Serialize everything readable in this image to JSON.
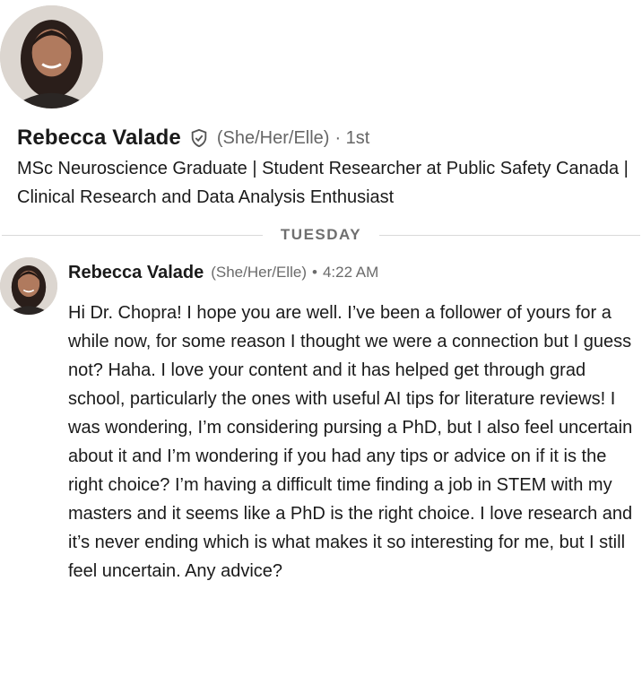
{
  "profile": {
    "name": "Rebecca Valade",
    "pronouns": "(She/Her/Elle)",
    "degree": "· 1st",
    "headline": "MSc Neuroscience Graduate | Student Researcher at Public Safety Canada | Clinical Research and Data Analysis Enthusiast",
    "verified_icon": "shield-check-icon"
  },
  "divider": {
    "label": "TUESDAY"
  },
  "message": {
    "sender": "Rebecca Valade",
    "pronouns": "(She/Her/Elle)",
    "separator": "•",
    "time": "4:22 AM",
    "text": "Hi Dr. Chopra! I hope you are well. I’ve been a follower of yours for a while now, for some reason I thought we were a connection but I guess not? Haha. I love your content and it has helped get through grad school, particularly the ones with useful AI tips for literature reviews! I was wondering, I’m considering pursing a PhD, but I also feel uncertain about it and I’m wondering if you had any tips or advice on if it is the right choice? I’m having a difficult time finding a job in STEM with my masters and it seems like a PhD is the right choice. I love research and it’s never ending which is what makes it so interesting for me, but I still feel uncertain. Any advice?"
  },
  "colors": {
    "text_primary": "#1a1a1a",
    "text_secondary": "#666666",
    "divider": "#d9d9d9"
  }
}
